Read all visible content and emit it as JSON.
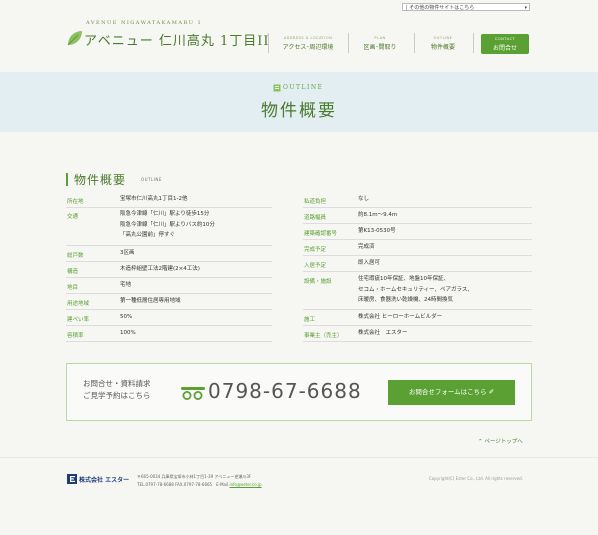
{
  "top": {
    "site_select": "| その他の物件サイトはこちら"
  },
  "header": {
    "logo_sub": "AVENUE NIGAWATAKAMARU 1",
    "logo_main": "アベニュー 仁川高丸 1丁目II",
    "nav": [
      {
        "en": "ADDRESS & LOCATION",
        "jp": "アクセス･周辺環境"
      },
      {
        "en": "PLAN",
        "jp": "区画･間取り"
      },
      {
        "en": "OUTLINE",
        "jp": "物件概要"
      }
    ],
    "contact": {
      "en": "CONTACT",
      "jp": "お問合せ"
    }
  },
  "band": {
    "en": "OUTLINE",
    "title": "物件概要"
  },
  "section": {
    "title": "物件概要",
    "en": "OUTLINE"
  },
  "left_rows": [
    {
      "label": "所在地",
      "value": "宝塚市仁川高丸1丁目1-2他"
    },
    {
      "label": "交通",
      "value": "阪急今津線「仁川」駅より徒歩15分\n阪急今津線「仁川」駅よりバス約10分\n「高丸公園前」停すぐ"
    },
    {
      "label": "総戸数",
      "value": "3区画"
    },
    {
      "label": "構造",
      "value": "木造枠組壁工法2階建(2×4工法)"
    },
    {
      "label": "地目",
      "value": "宅地"
    },
    {
      "label": "用途地域",
      "value": "第一種低層住居専用地域"
    },
    {
      "label": "建ぺい率",
      "value": "50%"
    },
    {
      "label": "容積率",
      "value": "100%"
    }
  ],
  "right_rows": [
    {
      "label": "私道負担",
      "value": "なし"
    },
    {
      "label": "道路幅員",
      "value": "約8.1m〜9.4m"
    },
    {
      "label": "建築確認番号",
      "value": "第K13-0530号"
    },
    {
      "label": "完成予定",
      "value": "完成済"
    },
    {
      "label": "入居予定",
      "value": "即入居可"
    },
    {
      "label": "設備・施設",
      "value": "住宅瑕疵10年保証、地盤10年保証、\nセコム・ホームセキュリティー、ペアガラス、\n床暖房、食器洗い乾燥機、24時間換気"
    },
    {
      "label": "施工",
      "value": "株式会社 ヒーローホームビルダー"
    },
    {
      "label": "事業主（売主）",
      "value": "株式会社　エスター"
    }
  ],
  "cta": {
    "text": "お問合せ・資料請求\nご見学予約はこちら",
    "phone": "0798-67-6688",
    "button": "お問合せフォームはこちら ✐"
  },
  "pagetop": "⌃ ページトップへ",
  "footer": {
    "company": "株式会社 エスター",
    "address": "〒665-0034 兵庫県宝塚市小林1丁目1-39 アベニュー逆瀬川3F",
    "contact_prefix": "TEL.0797-78-6688 FAX.0797-78-6665　E-Mail.",
    "email": "info@ester.co.jp",
    "copyright": "Copyright(C) Ester Co., Ltd. All rights reserved."
  },
  "colors": {
    "accent": "#5aa033",
    "band": "#e3eef2",
    "text": "#333333",
    "footer_logo": "#1e3c7a"
  }
}
